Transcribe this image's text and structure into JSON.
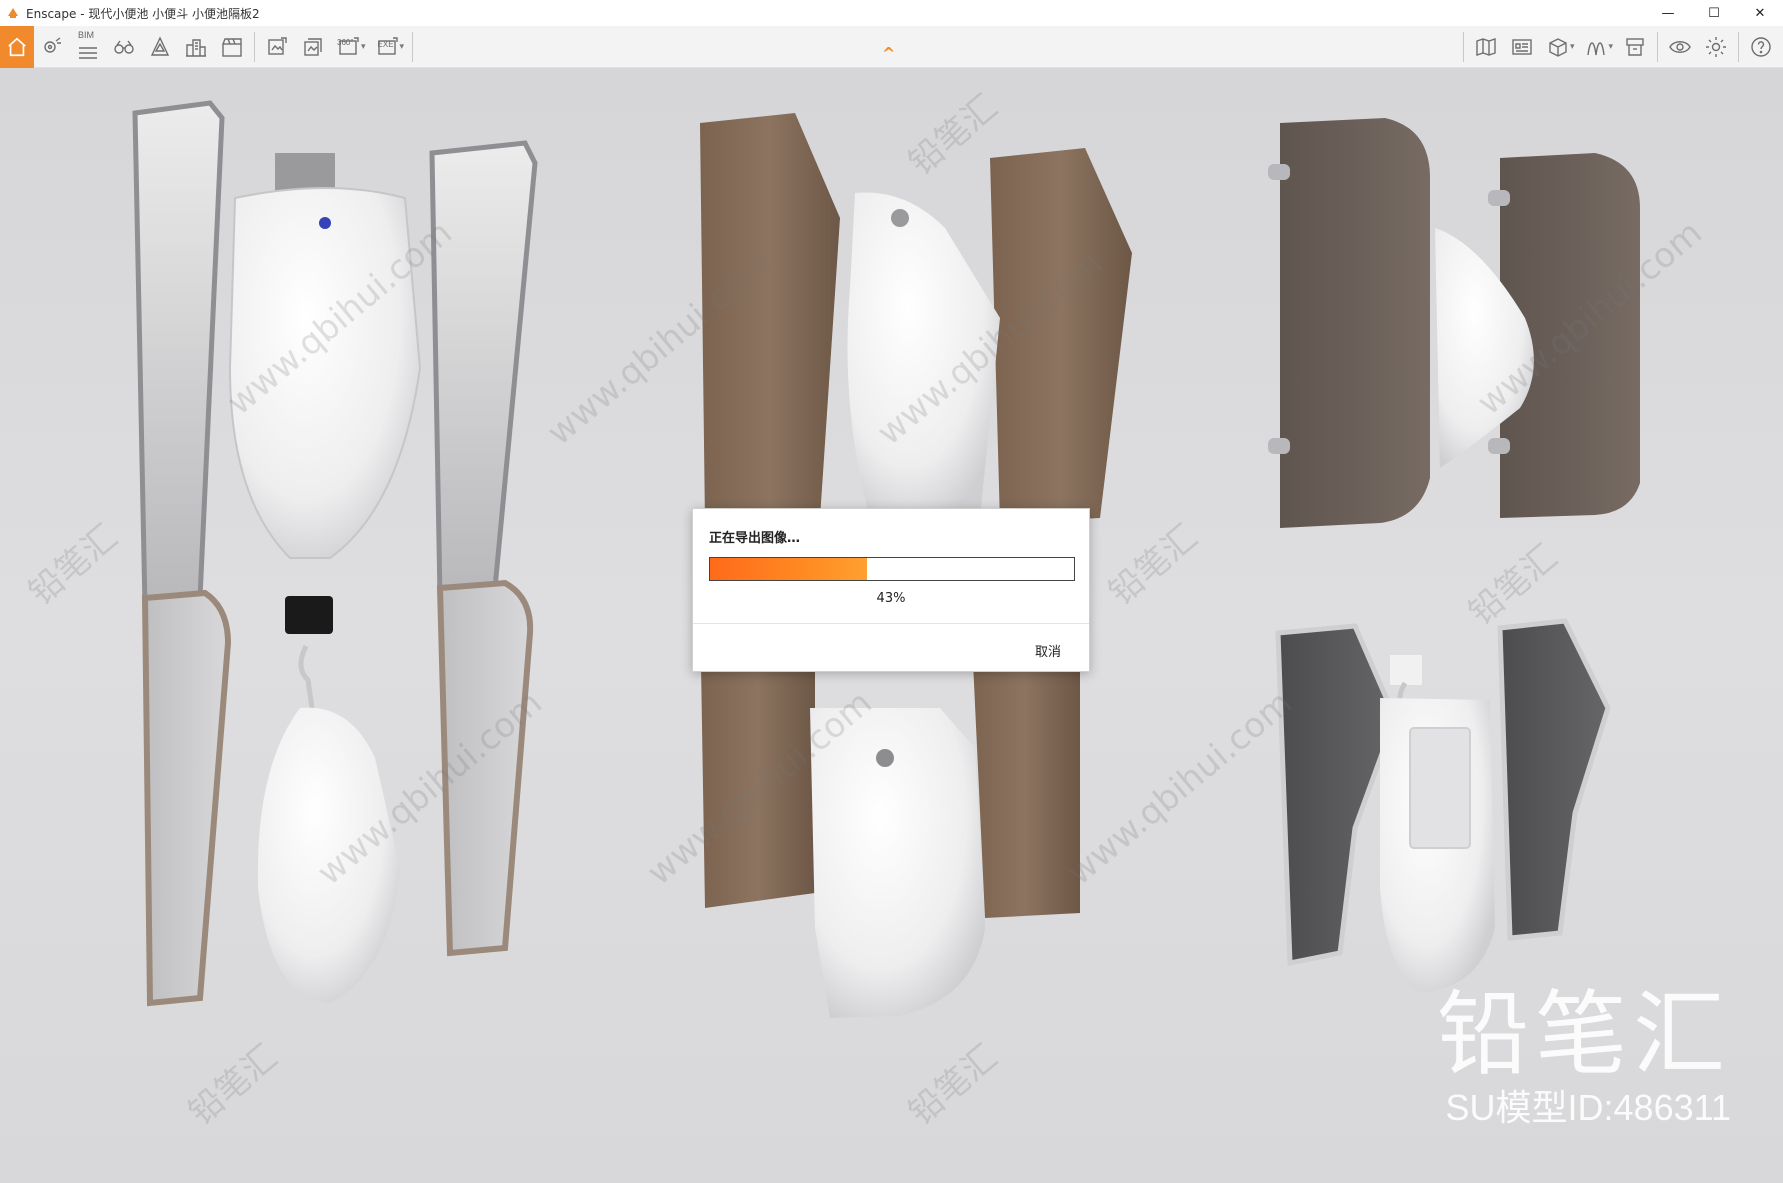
{
  "window": {
    "app_name": "Enscape",
    "title": "Enscape - 现代小便池 小便斗 小便池隔板2",
    "minimize": "—",
    "maximize": "☐",
    "close": "✕"
  },
  "toolbar": {
    "bim_label": "BIM",
    "panorama_label": "360°",
    "exe_label": "EXE",
    "left_icons": [
      "home-icon",
      "location-pin-icon",
      "bim-list-icon",
      "binoculars-icon",
      "bell-icon",
      "buildings-icon",
      "video-clapper-icon",
      "export-image-icon",
      "export-batch-icon",
      "export-panorama-icon",
      "export-exe-icon"
    ],
    "right_icons": [
      "map-icon",
      "asset-library-icon",
      "cube-view-icon",
      "curve-tool-icon",
      "archive-icon",
      "visibility-icon",
      "settings-icon",
      "help-icon"
    ],
    "collapse_symbol": "^",
    "accent_color": "#f08a2c"
  },
  "watermark": {
    "site_text": "www.qbihui.com",
    "brand_text": "铅笔汇",
    "brand_large": "铅笔汇",
    "model_id": "SU模型ID:486311"
  },
  "dialog": {
    "title": "正在导出图像…",
    "progress_fraction": 0.43,
    "percent_text": "43%",
    "cancel_label": "取消"
  }
}
